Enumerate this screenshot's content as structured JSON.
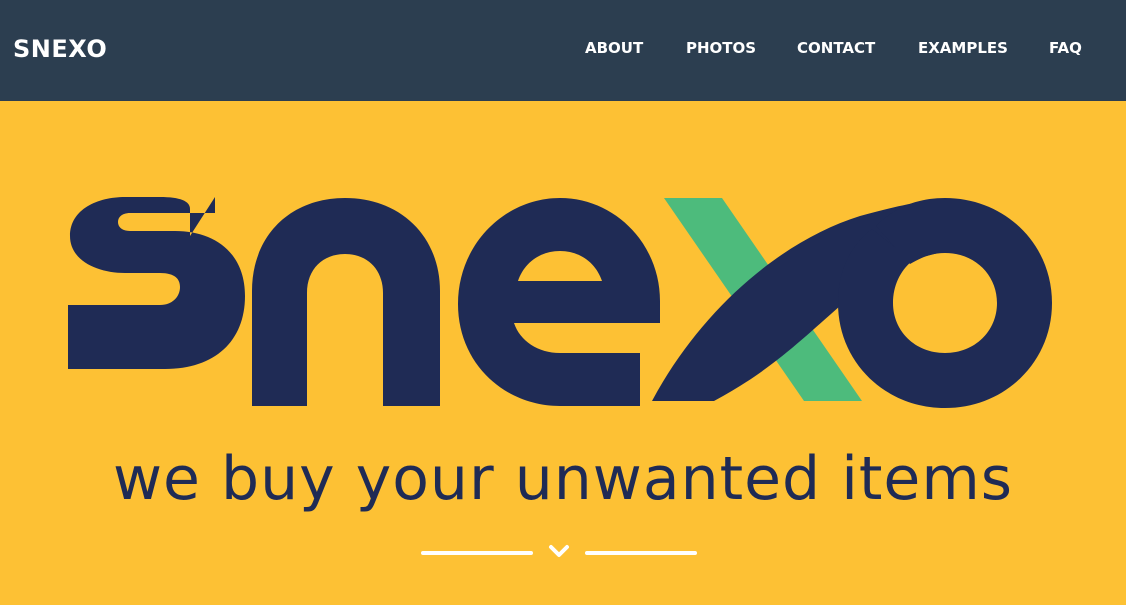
{
  "navbar": {
    "brand": "SNEXO",
    "links": [
      {
        "label": "ABOUT"
      },
      {
        "label": "PHOTOS"
      },
      {
        "label": "CONTACT"
      },
      {
        "label": "EXAMPLES"
      },
      {
        "label": "FAQ"
      }
    ]
  },
  "hero": {
    "logo_text": "snexo",
    "tagline": "we buy your unwanted items",
    "scroll_icon": "chevron-down-icon"
  },
  "colors": {
    "navbar_bg": "#2c3e50",
    "hero_bg": "#fdc134",
    "logo_navy": "#1f2b55",
    "logo_green": "#4dbb7c",
    "nav_text": "#ffffff"
  }
}
